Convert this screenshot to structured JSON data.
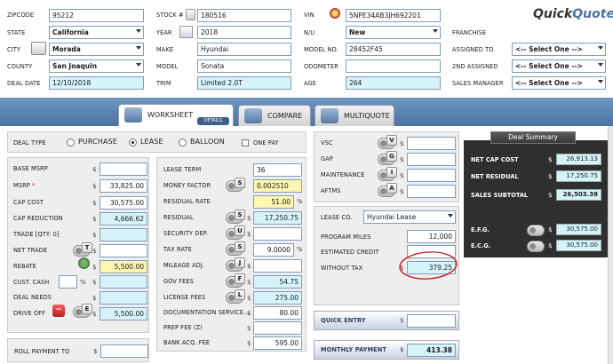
{
  "header": {
    "zipcode_label": "ZIPCODE",
    "zipcode": "95212",
    "stock_label": "STOCK #",
    "stock": "180516",
    "vin_label": "VIN",
    "vin": "5NPE34AB3JH692201",
    "state_label": "STATE",
    "state": "California",
    "year_label": "YEAR",
    "year": "2018",
    "nu_label": "N/U",
    "nu": "New",
    "franchise_label": "FRANCHISE",
    "city_label": "CITY",
    "city": "Morada",
    "make_label": "MAKE",
    "make": "Hyundai",
    "model_no_label": "MODEL NO.",
    "model_no": "28452F45",
    "assigned_to_label": "ASSIGNED TO",
    "assigned_to": "<-- Select One -->",
    "county_label": "COUNTY",
    "county": "San Joaquin",
    "model_label": "MODEL",
    "model": "Sonata",
    "odometer_label": "ODOMETER",
    "odometer": "",
    "second_assigned_label": "2ND ASSIGNED",
    "second_assigned": "<-- Select One -->",
    "deal_date_label": "DEAL DATE",
    "deal_date": "12/10/2018",
    "trim_label": "TRIM",
    "trim": "Limited 2.0T",
    "age_label": "AGE",
    "age": "264",
    "sales_manager_label": "SALES MANAGER",
    "sales_manager": "<-- Select One -->"
  },
  "brand": {
    "quick": "Quick",
    "quote": "Quote"
  },
  "tabs": [
    {
      "label": "WORKSHEET",
      "sub": "DETAILS"
    },
    {
      "label": "COMPARE"
    },
    {
      "label": "MULTIQUOTE"
    }
  ],
  "deal_type": {
    "label": "DEAL TYPE",
    "options": [
      "PURCHASE",
      "LEASE",
      "BALLOON"
    ],
    "selected": "LEASE",
    "one_pay": "ONE PAY"
  },
  "left": {
    "base_msrp_label": "BASE MSRP",
    "base_msrp": "",
    "msrp_label": "MSRP",
    "msrp_star": "*",
    "msrp": "33,825.00",
    "cap_cost_label": "CAP COST",
    "cap_cost": "30,575.00",
    "cap_reduction_label": "CAP REDUCTION",
    "cap_reduction": "4,666.62",
    "trade_label": "TRADE [QTY: 0]",
    "trade": "",
    "net_trade_label": "NET TRADE",
    "net_trade": "",
    "rebate_label": "REBATE",
    "rebate": "5,500.00",
    "cust_cash_label": "CUST. CASH",
    "cust_cash": "",
    "deal_needs_label": "DEAL NEEDS",
    "deal_needs": "",
    "drive_off_label": "DRIVE OFF",
    "drive_off": "5,500.00",
    "roll_payment_label": "ROLL PAYMENT TO",
    "roll_payment": ""
  },
  "middle": {
    "lease_term_label": "LEASE TERM",
    "lease_term": "36",
    "money_factor_label": "MONEY FACTOR",
    "money_factor": "0.002510",
    "residual_rate_label": "RESIDUAL RATE",
    "residual_rate": "51.00",
    "residual_label": "RESIDUAL",
    "residual": "17,250.75",
    "security_dep_label": "SECURITY DEP.",
    "security_dep": "",
    "tax_rate_label": "TAX RATE",
    "tax_rate": "9.0000",
    "mileage_adj_label": "MILEAGE ADJ.",
    "mileage_adj": "",
    "gov_fees_label": "GOV FEES",
    "gov_fees": "54.75",
    "license_fees_label": "LICENSE FEES",
    "license_fees": "275.00",
    "doc_service_label": "DOCUMENTATION SERVICE...",
    "doc_service": "80.00",
    "prep_fee_label": "PREP FEE (Z)",
    "prep_fee": "",
    "bank_acq_label": "BANK ACQ. FEE",
    "bank_acq": "595.00"
  },
  "right": {
    "vsc_label": "VSC",
    "vsc": "",
    "gap_label": "GAP",
    "gap": "",
    "maintenance_label": "MAINTENANCE",
    "maintenance": "",
    "aftms_label": "AFTMS",
    "aftms": "",
    "lease_co_label": "LEASE CO.",
    "lease_co": "Hyundai Lease",
    "program_miles_label": "PROGRAM MILES",
    "program_miles": "12,000",
    "estimated_credit_label": "ESTIMATED CREDIT",
    "estimated_credit": "",
    "without_tax_label": "WITHOUT TAX",
    "without_tax": "379.25",
    "quick_entry_label": "QUICK ENTRY",
    "quick_entry": "",
    "monthly_payment_label": "MONTHLY PAYMENT",
    "monthly_payment": "413.38"
  },
  "summary": {
    "title": "Deal Summary",
    "net_cap_cost_label": "NET CAP COST",
    "net_cap_cost": "26,913.13",
    "net_residual_label": "NET RESIDUAL",
    "net_residual": "17,250.75",
    "sales_subtotal_label": "SALES SUBTOTAL",
    "sales_subtotal": "26,503.38",
    "efg_label": "E.F.G.",
    "efg": "30,575.00",
    "ecg_label": "E.C.G.",
    "ecg": "30,575.00"
  },
  "icons": {
    "keys": [
      "S",
      "R",
      "S",
      "U",
      "S",
      "J",
      "F",
      "L",
      "V",
      "G",
      "I",
      "A",
      "T",
      "E"
    ]
  },
  "colors": {
    "brand_blue": "#4a72a3",
    "cyan_field": "#d6f3fa",
    "yellow_field": "#fff6b0",
    "highlight_red": "#c0141c"
  }
}
